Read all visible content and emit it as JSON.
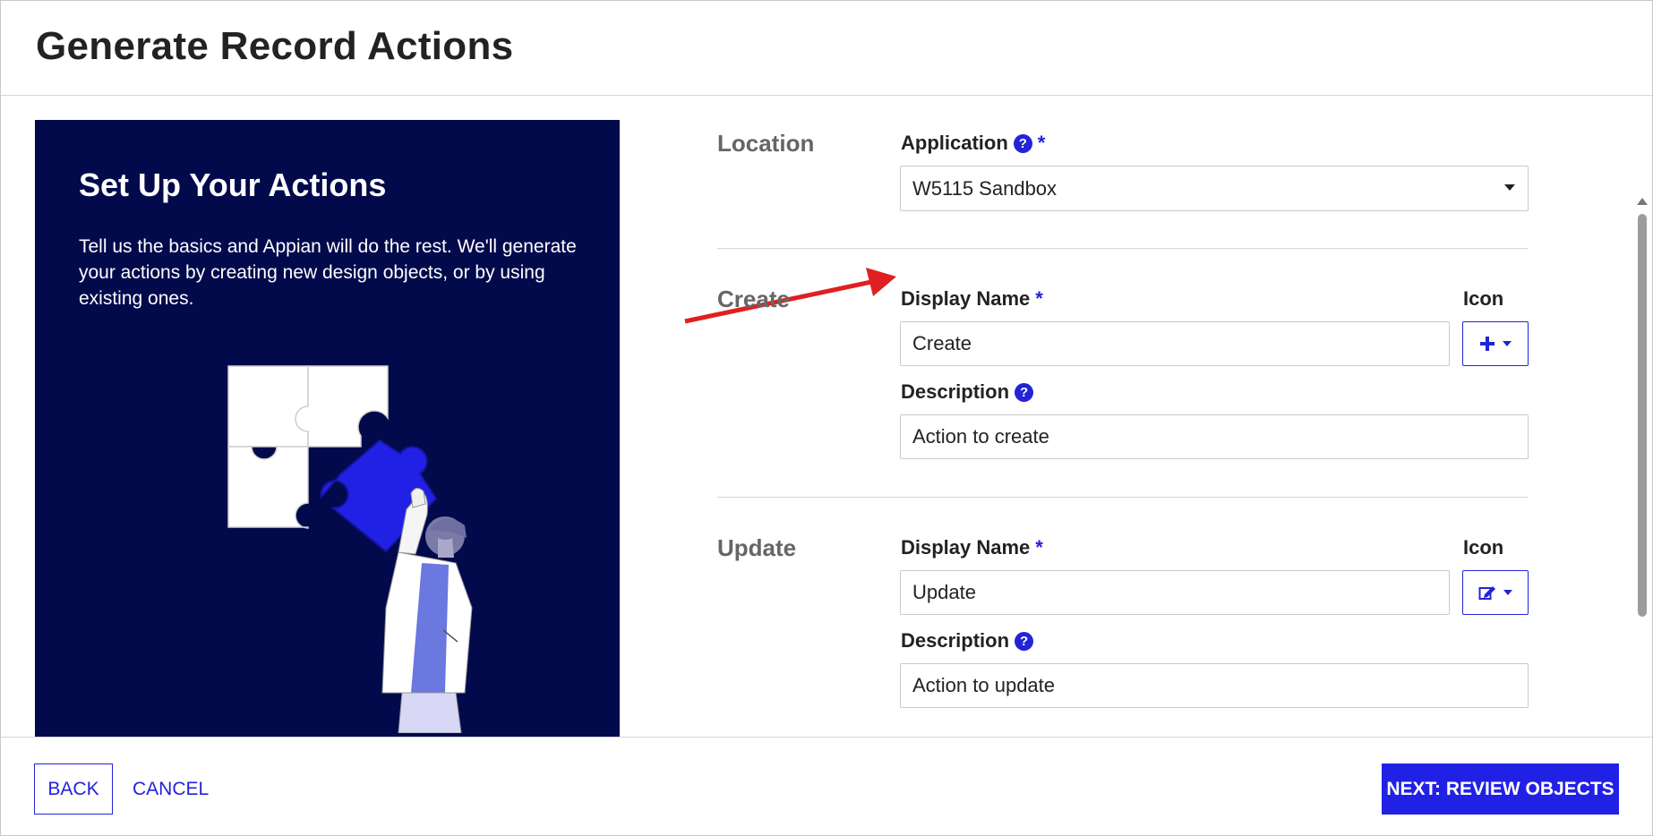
{
  "dialog": {
    "title": "Generate Record Actions"
  },
  "hero": {
    "heading": "Set Up Your Actions",
    "body": "Tell us the basics and Appian will do the rest. We'll generate your actions by creating new design objects, or by using existing ones.",
    "background_color": "#020a4c",
    "illustration": "person-holding-puzzle-piece"
  },
  "location": {
    "section_title": "Location",
    "application_label": "Application",
    "required_mark": "*",
    "application_value": "W5115 Sandbox"
  },
  "create": {
    "section_title": "Create",
    "display_name_label": "Display Name",
    "required_mark": "*",
    "display_name_value": "Create",
    "icon_label": "Icon",
    "icon_name": "plus-icon",
    "description_label": "Description",
    "description_value": "Action to create"
  },
  "update": {
    "section_title": "Update",
    "display_name_label": "Display Name",
    "required_mark": "*",
    "display_name_value": "Update",
    "icon_label": "Icon",
    "icon_name": "edit-icon",
    "description_label": "Description",
    "description_value": "Action to update"
  },
  "footer": {
    "back_label": "BACK",
    "cancel_label": "CANCEL",
    "next_label": "NEXT: REVIEW OBJECTS"
  },
  "colors": {
    "accent": "#2323d8",
    "primary_button": "#2121e6",
    "annotation_arrow": "#e02020"
  }
}
